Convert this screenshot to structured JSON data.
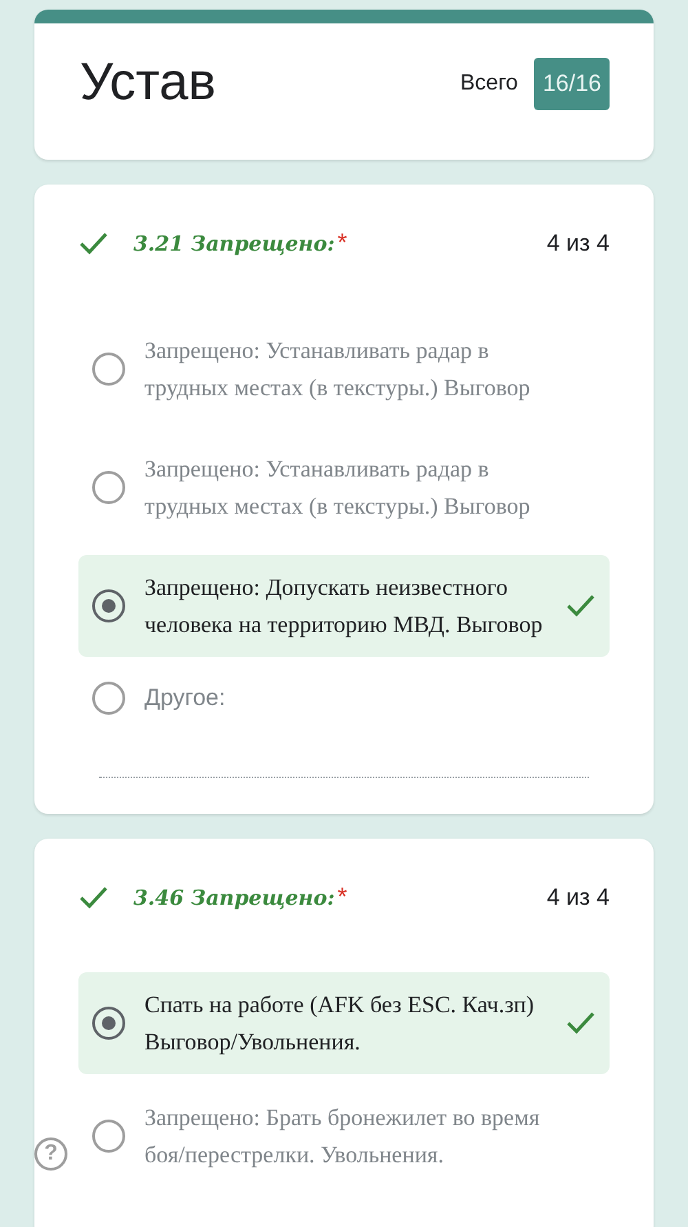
{
  "header": {
    "title": "Устав",
    "total_label": "Всего",
    "score": "16/16"
  },
  "questions": [
    {
      "title": "3.21 Запрещено:",
      "required_mark": "*",
      "correct": true,
      "points": "4 из 4",
      "options": [
        {
          "kind": "choice",
          "label": "Запрещено: Устанавливать радар в трудных местах (в текстуры.) Выговор",
          "selected": false,
          "correct": false
        },
        {
          "kind": "choice",
          "label": "Запрещено: Устанавливать радар в трудных местах (в текстуры.) Выговор",
          "selected": false,
          "correct": false
        },
        {
          "kind": "choice",
          "label": "Запрещено: Допускать неизвестного человека на территорию МВД. Выговор",
          "selected": true,
          "correct": true
        },
        {
          "kind": "other",
          "label": "Другое:",
          "selected": false,
          "correct": false
        }
      ]
    },
    {
      "title": "3.46 Запрещено:",
      "required_mark": "*",
      "correct": true,
      "points": "4 из 4",
      "options": [
        {
          "kind": "choice",
          "label": "Спать на работе (AFK без ESC. Кач.зп) Выговор/Увольнения.",
          "selected": true,
          "correct": true
        },
        {
          "kind": "choice",
          "label": "Запрещено: Брать бронежилет во время боя/перестрелки. Увольнения.",
          "selected": false,
          "correct": false
        }
      ]
    }
  ],
  "help": {
    "label": "?"
  }
}
